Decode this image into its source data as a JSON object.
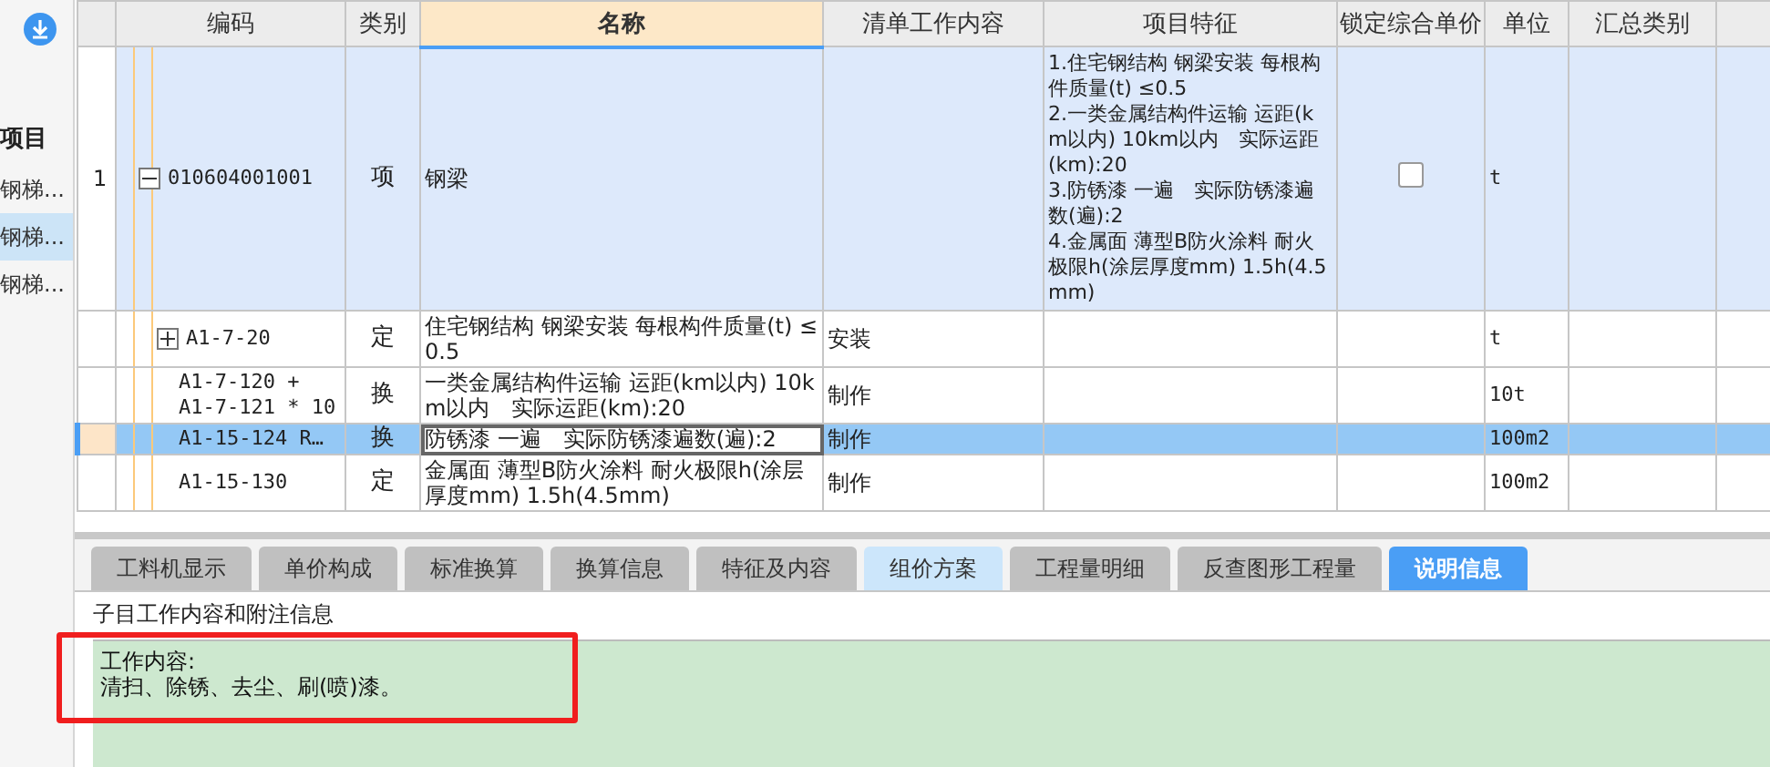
{
  "sidebar": {
    "header": "项目",
    "items": [
      {
        "label": "钢梯...",
        "selected": false
      },
      {
        "label": "钢梯...",
        "selected": true
      },
      {
        "label": "钢梯...",
        "selected": false
      }
    ]
  },
  "table": {
    "columns": [
      {
        "label": "编码",
        "active": false
      },
      {
        "label": "类别",
        "active": false
      },
      {
        "label": "名称",
        "active": true
      },
      {
        "label": "清单工作内容",
        "active": false
      },
      {
        "label": "项目特征",
        "active": false
      },
      {
        "label": "锁定综合单价",
        "active": false
      },
      {
        "label": "单位",
        "active": false
      },
      {
        "label": "汇总类别",
        "active": false
      }
    ],
    "rows": [
      {
        "kind": "bill",
        "number": "1",
        "expanded": true,
        "code": "010604001001",
        "type": "项",
        "name": "钢梁",
        "features": "1.住宅钢结构 钢梁安装 每根构件质量(t) ≤0.5\n2.一类金属结构件运输 运距(km以内) 10km以内　实际运距(km):20\n3.防锈漆 一遍　实际防锈漆遍数(遍):2\n4.金属面 薄型B防火涂料 耐火极限h(涂层厚度mm) 1.5h(4.5mm)",
        "locked": false,
        "unit": "t",
        "selected": false,
        "editing": false
      },
      {
        "kind": "quota",
        "expanded": false,
        "code": "A1-7-20",
        "type": "定",
        "name": "住宅钢结构 钢梁安装 每根构件质量(t) ≤0.5",
        "work_content": "安装",
        "unit": "t",
        "selected": false,
        "editing": false
      },
      {
        "kind": "quota",
        "code": "A1-7-120 +\nA1-7-121 * 10",
        "type": "换",
        "name": "一类金属结构件运输 运距(km以内) 10km以内　实际运距(km):20",
        "work_content": "制作",
        "unit": "10t",
        "selected": false,
        "editing": false
      },
      {
        "kind": "quota",
        "code": "A1-15-124 R…",
        "type": "换",
        "name": "防锈漆 一遍　实际防锈漆遍数(遍):2",
        "work_content": "制作",
        "unit": "100m2",
        "selected": true,
        "editing": true
      },
      {
        "kind": "quota",
        "code": "A1-15-130",
        "type": "定",
        "name": "金属面 薄型B防火涂料 耐火极限h(涂层厚度mm) 1.5h(4.5mm)",
        "work_content": "制作",
        "unit": "100m2",
        "selected": false,
        "editing": false
      }
    ]
  },
  "bottom_tabs": [
    {
      "label": "工料机显示",
      "selected": false,
      "hovered": false
    },
    {
      "label": "单价构成",
      "selected": false,
      "hovered": false
    },
    {
      "label": "标准换算",
      "selected": false,
      "hovered": false
    },
    {
      "label": "换算信息",
      "selected": false,
      "hovered": false
    },
    {
      "label": "特征及内容",
      "selected": false,
      "hovered": false
    },
    {
      "label": "组价方案",
      "selected": false,
      "hovered": true
    },
    {
      "label": "工程量明细",
      "selected": false,
      "hovered": false
    },
    {
      "label": "反查图形工程量",
      "selected": false,
      "hovered": false
    },
    {
      "label": "说明信息",
      "selected": true,
      "hovered": false
    }
  ],
  "notes": {
    "label": "子目工作内容和附注信息",
    "text": "工作内容:\n清扫、除锈、去尘、刷(喷)漆。"
  }
}
